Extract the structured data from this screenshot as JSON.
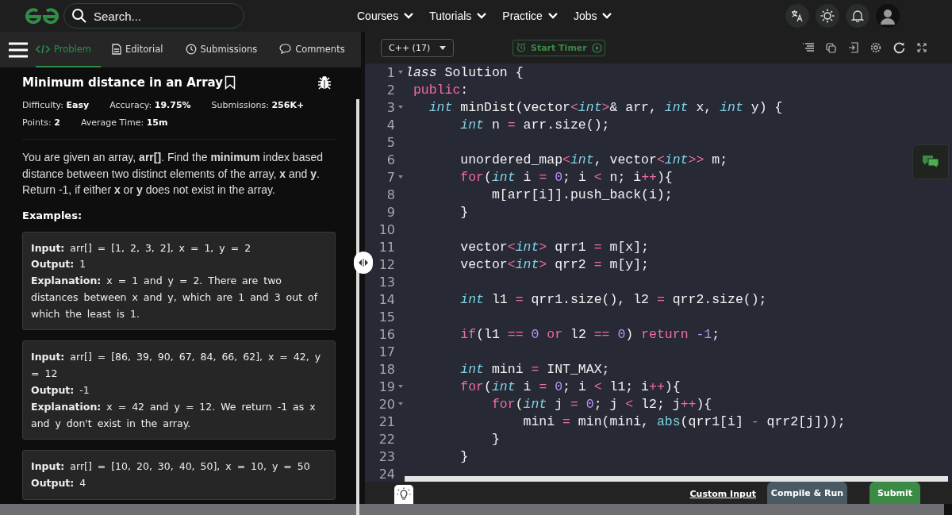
{
  "topbar": {
    "search": {
      "placeholder": "Search..."
    },
    "menu": [
      {
        "label": "Courses"
      },
      {
        "label": "Tutorials"
      },
      {
        "label": "Practice"
      },
      {
        "label": "Jobs"
      }
    ]
  },
  "problem_panel": {
    "tabs": [
      {
        "label": "Problem",
        "selected": true
      },
      {
        "label": "Editorial",
        "selected": false
      },
      {
        "label": "Submissions",
        "selected": false
      },
      {
        "label": "Comments",
        "selected": false
      }
    ],
    "title": "Minimum distance in an Array",
    "meta": [
      [
        {
          "label": "Difficulty:",
          "value": "Easy"
        },
        {
          "label": "Accuracy:",
          "value": "19.75%"
        },
        {
          "label": "Submissions:",
          "value": "256K+"
        }
      ],
      [
        {
          "label": "Points:",
          "value": "2"
        },
        {
          "label": "Average Time:",
          "value": "15m"
        }
      ]
    ],
    "description": "You are given an array, **arr[]**. Find the **minimum** index based distance between two distinct elements of the array, **x** and **y**. Return -1, if either **x** or **y** does not exist in the array.",
    "examples_heading": "Examples:",
    "examples": [
      [
        "**Input:** arr[] = [1, 2, 3, 2], x = 1, y = 2",
        "**Output:** 1",
        "**Explanation:** x = 1 and y = 2. There are two distances between x and y, which are 1 and 3 out of which the least is 1."
      ],
      [
        "**Input:** arr[] = [86, 39, 90, 67, 84, 66, 62], x = 42, y = 12",
        "**Output:** -1",
        "**Explanation:** x = 42 and y = 12. We return -1 as x and y don't exist in the array."
      ],
      [
        "**Input:** arr[] = [10, 20, 30, 40, 50], x = 10, y = 50",
        "**Output:** 4"
      ]
    ]
  },
  "editor": {
    "language": "C++ (17)",
    "timer_label": "Start Timer",
    "lines": [
      {
        "number": "1",
        "fold": true,
        "tokens": [
          {
            "kind": "storage",
            "text": "lass"
          },
          {
            "kind": "plain",
            "text": " Solution {"
          }
        ]
      },
      {
        "number": "2",
        "fold": false,
        "tokens": [
          {
            "kind": "keyword",
            "text": " public"
          },
          {
            "kind": "plain",
            "text": ":"
          }
        ]
      },
      {
        "number": "3",
        "fold": true,
        "tokens": [
          {
            "kind": "type",
            "text": "   int"
          },
          {
            "kind": "plain",
            "text": " minDist(vector"
          },
          {
            "kind": "op",
            "text": "<"
          },
          {
            "kind": "type",
            "text": "int"
          },
          {
            "kind": "op",
            "text": ">"
          },
          {
            "kind": "plain",
            "text": "& arr, "
          },
          {
            "kind": "type",
            "text": "int"
          },
          {
            "kind": "plain",
            "text": " x, "
          },
          {
            "kind": "type",
            "text": "int"
          },
          {
            "kind": "plain",
            "text": " y) {"
          }
        ]
      },
      {
        "number": "4",
        "fold": false,
        "tokens": [
          {
            "kind": "type",
            "text": "       int"
          },
          {
            "kind": "plain",
            "text": " n "
          },
          {
            "kind": "op",
            "text": "="
          },
          {
            "kind": "plain",
            "text": " arr.size();"
          }
        ]
      },
      {
        "number": "5",
        "fold": false
      },
      {
        "number": "6",
        "fold": false,
        "tokens": [
          {
            "kind": "plain",
            "text": "       unordered_map"
          },
          {
            "kind": "op",
            "text": "<"
          },
          {
            "kind": "type",
            "text": "int"
          },
          {
            "kind": "plain",
            "text": ", vector"
          },
          {
            "kind": "op",
            "text": "<"
          },
          {
            "kind": "type",
            "text": "int"
          },
          {
            "kind": "op",
            "text": ">>"
          },
          {
            "kind": "plain",
            "text": " m;"
          }
        ]
      },
      {
        "number": "7",
        "fold": true,
        "tokens": [
          {
            "kind": "keyword",
            "text": "       for"
          },
          {
            "kind": "plain",
            "text": "("
          },
          {
            "kind": "type",
            "text": "int"
          },
          {
            "kind": "plain",
            "text": " i "
          },
          {
            "kind": "op",
            "text": "="
          },
          {
            "kind": "number",
            "text": " 0"
          },
          {
            "kind": "plain",
            "text": "; i "
          },
          {
            "kind": "op",
            "text": "<"
          },
          {
            "kind": "plain",
            "text": " n; i"
          },
          {
            "kind": "op",
            "text": "++"
          },
          {
            "kind": "plain",
            "text": "){"
          }
        ]
      },
      {
        "number": "8",
        "fold": false,
        "tokens": [
          {
            "kind": "plain",
            "text": "           m[arr[i]].push_back(i);"
          }
        ]
      },
      {
        "number": "9",
        "fold": false,
        "tokens": [
          {
            "kind": "plain",
            "text": "       }"
          }
        ]
      },
      {
        "number": "10",
        "fold": false
      },
      {
        "number": "11",
        "fold": false,
        "tokens": [
          {
            "kind": "plain",
            "text": "       vector"
          },
          {
            "kind": "op",
            "text": "<"
          },
          {
            "kind": "type",
            "text": "int"
          },
          {
            "kind": "op",
            "text": ">"
          },
          {
            "kind": "plain",
            "text": " qrr1 "
          },
          {
            "kind": "op",
            "text": "="
          },
          {
            "kind": "plain",
            "text": " m[x];"
          }
        ]
      },
      {
        "number": "12",
        "fold": false,
        "tokens": [
          {
            "kind": "plain",
            "text": "       vector"
          },
          {
            "kind": "op",
            "text": "<"
          },
          {
            "kind": "type",
            "text": "int"
          },
          {
            "kind": "op",
            "text": ">"
          },
          {
            "kind": "plain",
            "text": " qrr2 "
          },
          {
            "kind": "op",
            "text": "="
          },
          {
            "kind": "plain",
            "text": " m[y];"
          }
        ]
      },
      {
        "number": "13",
        "fold": false
      },
      {
        "number": "14",
        "fold": false,
        "tokens": [
          {
            "kind": "type",
            "text": "       int"
          },
          {
            "kind": "plain",
            "text": " l1 "
          },
          {
            "kind": "op",
            "text": "="
          },
          {
            "kind": "plain",
            "text": " qrr1.size(), l2 "
          },
          {
            "kind": "op",
            "text": "="
          },
          {
            "kind": "plain",
            "text": " qrr2.size();"
          }
        ]
      },
      {
        "number": "15",
        "fold": false
      },
      {
        "number": "16",
        "fold": false,
        "tokens": [
          {
            "kind": "keyword",
            "text": "       if"
          },
          {
            "kind": "plain",
            "text": "(l1 "
          },
          {
            "kind": "op",
            "text": "=="
          },
          {
            "kind": "number",
            "text": " 0"
          },
          {
            "kind": "keyword",
            "text": " or"
          },
          {
            "kind": "plain",
            "text": " l2 "
          },
          {
            "kind": "op",
            "text": "=="
          },
          {
            "kind": "number",
            "text": " 0"
          },
          {
            "kind": "plain",
            "text": ") "
          },
          {
            "kind": "keyword",
            "text": "return"
          },
          {
            "kind": "number",
            "text": " -1"
          },
          {
            "kind": "plain",
            "text": ";"
          }
        ]
      },
      {
        "number": "17",
        "fold": false
      },
      {
        "number": "18",
        "fold": false,
        "tokens": [
          {
            "kind": "type",
            "text": "       int"
          },
          {
            "kind": "plain",
            "text": " mini "
          },
          {
            "kind": "op",
            "text": "="
          },
          {
            "kind": "plain",
            "text": " INT_MAX;"
          }
        ]
      },
      {
        "number": "19",
        "fold": true,
        "tokens": [
          {
            "kind": "keyword",
            "text": "       for"
          },
          {
            "kind": "plain",
            "text": "("
          },
          {
            "kind": "type",
            "text": "int"
          },
          {
            "kind": "plain",
            "text": " i "
          },
          {
            "kind": "op",
            "text": "="
          },
          {
            "kind": "number",
            "text": " 0"
          },
          {
            "kind": "plain",
            "text": "; i "
          },
          {
            "kind": "op",
            "text": "<"
          },
          {
            "kind": "plain",
            "text": " l1; i"
          },
          {
            "kind": "op",
            "text": "++"
          },
          {
            "kind": "plain",
            "text": "){"
          }
        ]
      },
      {
        "number": "20",
        "fold": true,
        "tokens": [
          {
            "kind": "keyword",
            "text": "           for"
          },
          {
            "kind": "plain",
            "text": "("
          },
          {
            "kind": "type",
            "text": "int"
          },
          {
            "kind": "plain",
            "text": " j "
          },
          {
            "kind": "op",
            "text": "="
          },
          {
            "kind": "number",
            "text": " 0"
          },
          {
            "kind": "plain",
            "text": "; j "
          },
          {
            "kind": "op",
            "text": "<"
          },
          {
            "kind": "plain",
            "text": " l2; j"
          },
          {
            "kind": "op",
            "text": "++"
          },
          {
            "kind": "plain",
            "text": "){"
          }
        ]
      },
      {
        "number": "21",
        "fold": false,
        "tokens": [
          {
            "kind": "plain",
            "text": "               mini "
          },
          {
            "kind": "op",
            "text": "="
          },
          {
            "kind": "plain",
            "text": " min(mini, "
          },
          {
            "kind": "func",
            "text": "abs"
          },
          {
            "kind": "plain",
            "text": "(qrr1[i] "
          },
          {
            "kind": "op",
            "text": "-"
          },
          {
            "kind": "plain",
            "text": " qrr2[j]));"
          }
        ]
      },
      {
        "number": "22",
        "fold": false,
        "tokens": [
          {
            "kind": "plain",
            "text": "           }"
          }
        ]
      },
      {
        "number": "23",
        "fold": false,
        "tokens": [
          {
            "kind": "plain",
            "text": "       }"
          }
        ]
      },
      {
        "number": "24",
        "fold": false
      }
    ],
    "custom_input": "Custom Input",
    "compile_label": "Compile & Run",
    "submit_label": "Submit"
  }
}
